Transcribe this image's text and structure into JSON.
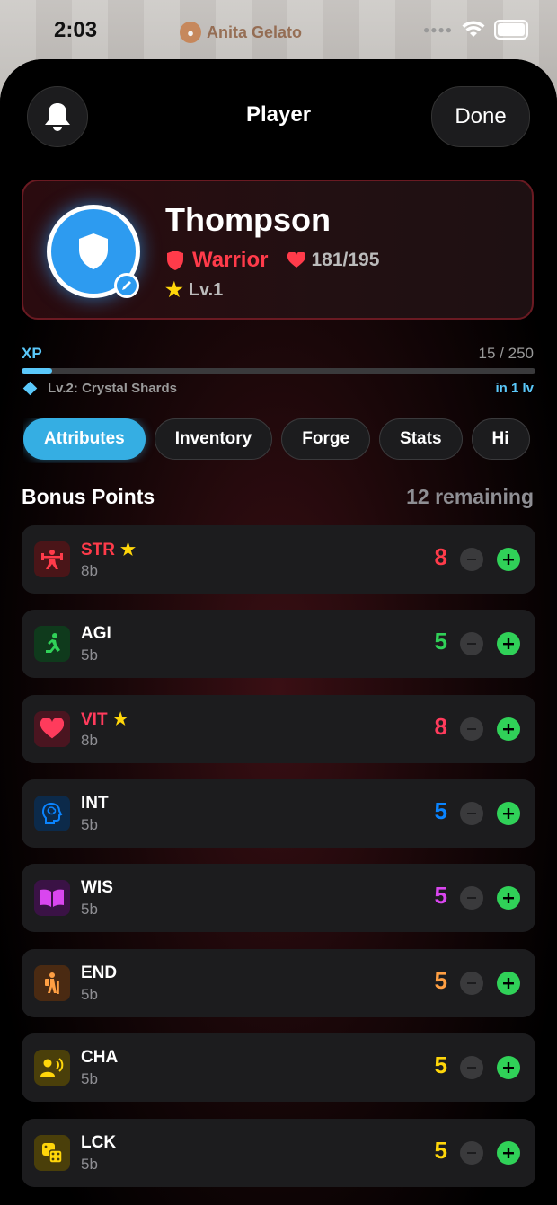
{
  "status_bar": {
    "time": "2:03",
    "location": "Anita Gelato"
  },
  "header": {
    "title": "Player",
    "done_label": "Done"
  },
  "player": {
    "name": "Thompson",
    "class": "Warrior",
    "hp": "181/195",
    "level": "Lv.1"
  },
  "xp": {
    "label": "XP",
    "value": "15 / 250",
    "progress": 0.06,
    "next_reward": "Lv.2: Crystal Shards",
    "next_in": "in 1 lv"
  },
  "tabs": [
    {
      "label": "Attributes"
    },
    {
      "label": "Inventory"
    },
    {
      "label": "Forge"
    },
    {
      "label": "Stats"
    },
    {
      "label": "Hi"
    }
  ],
  "bonus": {
    "title": "Bonus Points",
    "remaining": "12 remaining"
  },
  "attributes": [
    {
      "name": "STR",
      "sub": "8b",
      "value": "8",
      "star": true,
      "color": "#ff3b4a",
      "icon": "weightlifter-icon"
    },
    {
      "name": "AGI",
      "sub": "5b",
      "value": "5",
      "star": false,
      "color": "#30d158",
      "icon": "runner-icon"
    },
    {
      "name": "VIT",
      "sub": "8b",
      "value": "8",
      "star": true,
      "color": "#ff3b5c",
      "icon": "heart-icon"
    },
    {
      "name": "INT",
      "sub": "5b",
      "value": "5",
      "star": false,
      "color": "#0a84ff",
      "icon": "brain-head-icon"
    },
    {
      "name": "WIS",
      "sub": "5b",
      "value": "5",
      "star": false,
      "color": "#d946ef",
      "icon": "book-icon"
    },
    {
      "name": "END",
      "sub": "5b",
      "value": "5",
      "star": false,
      "color": "#ff9f43",
      "icon": "hiker-icon"
    },
    {
      "name": "CHA",
      "sub": "5b",
      "value": "5",
      "star": false,
      "color": "#ffd60a",
      "icon": "speaking-person-icon"
    },
    {
      "name": "LCK",
      "sub": "5b",
      "value": "5",
      "star": false,
      "color": "#ffd60a",
      "icon": "dice-icon"
    }
  ]
}
